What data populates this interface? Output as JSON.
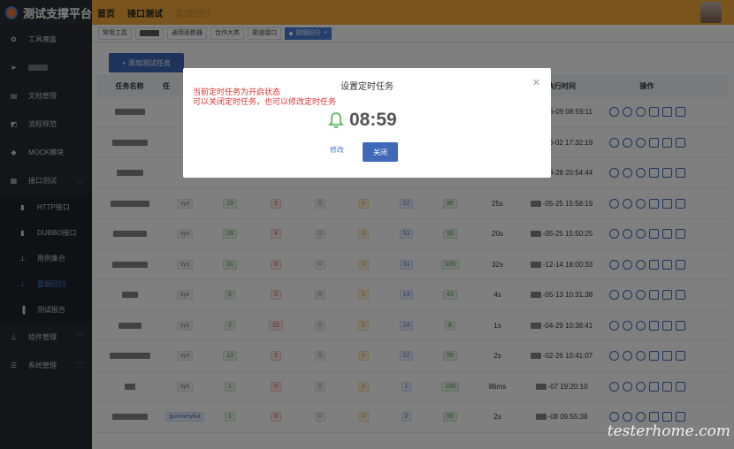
{
  "app": {
    "title": "测试支撑平台",
    "nav": [
      "首页",
      "接口测试",
      "冒烟回归"
    ]
  },
  "sidebar": {
    "items": [
      {
        "label": "工具魔盒",
        "icon": "gear-icon"
      },
      {
        "label": "■■■",
        "icon": "send-icon",
        "blurred": true
      },
      {
        "label": "文档管理",
        "icon": "doc-icon"
      },
      {
        "label": "流程规范",
        "icon": "flow-icon"
      },
      {
        "label": "MOCK模块",
        "icon": "box-icon"
      },
      {
        "label": "接口测试",
        "icon": "grid-icon",
        "expanded": true
      }
    ],
    "subitems": [
      {
        "label": "HTTP接口",
        "icon": "doc-icon"
      },
      {
        "label": "DUBBO接口",
        "icon": "doc-icon"
      },
      {
        "label": "用例集合",
        "icon": "tree-icon"
      },
      {
        "label": "冒烟回归",
        "icon": "tree-icon",
        "active": true
      },
      {
        "label": "测试报告",
        "icon": "bar-icon"
      }
    ],
    "bottom": [
      {
        "label": "组件管理",
        "icon": "tree-icon"
      },
      {
        "label": "系统管理",
        "icon": "list-icon"
      }
    ]
  },
  "tabs": [
    {
      "label": "常用工具"
    },
    {
      "label": "■■■",
      "blurred": true
    },
    {
      "label": "通用适数器"
    },
    {
      "label": "合作大类"
    },
    {
      "label": "渠道接口"
    },
    {
      "label": "冒烟回归",
      "active": true
    }
  ],
  "add_button": "+ 添加测试任务",
  "table": {
    "headers": [
      "任务名称",
      "任",
      "",
      "",
      "",
      "",
      "",
      "",
      "",
      "执行时间",
      "操作"
    ],
    "rows": [
      {
        "creator": "",
        "total": "",
        "fail": "",
        "skip": "",
        "warn": "",
        "pass": "",
        "pct": "",
        "dur": "",
        "time": "-06-09 08:59:11"
      },
      {
        "creator": "",
        "total": "",
        "fail": "",
        "skip": "",
        "warn": "",
        "pass": "",
        "pct": "",
        "dur": "",
        "time": "-06-02 17:32:19"
      },
      {
        "creator": "",
        "total": "",
        "fail": "",
        "skip": "",
        "warn": "",
        "pass": "",
        "pct": "",
        "dur": "",
        "time": "-08-28 20:54:44"
      },
      {
        "creator": "sys",
        "total": "19",
        "fail": "3",
        "skip": "0",
        "warn": "0",
        "pass": "22",
        "pct": "86",
        "dur": "25s",
        "time": "-05-25 15:58:19"
      },
      {
        "creator": "sys",
        "total": "28",
        "fail": "4",
        "skip": "0",
        "warn": "0",
        "pass": "51",
        "pct": "55",
        "dur": "20s",
        "time": "-05-25 15:50:25"
      },
      {
        "creator": "sys",
        "total": "31",
        "fail": "0",
        "skip": "0",
        "warn": "0",
        "pass": "31",
        "pct": "100",
        "dur": "32s",
        "time": "-12-14 18:00:33"
      },
      {
        "creator": "sys",
        "total": "6",
        "fail": "0",
        "skip": "0",
        "warn": "0",
        "pass": "14",
        "pct": "43",
        "dur": "4s",
        "time": "-05-13 10:31:38"
      },
      {
        "creator": "sys",
        "total": "2",
        "fail": "22",
        "skip": "0",
        "warn": "0",
        "pass": "24",
        "pct": "8",
        "dur": "1s",
        "time": "-04-29 10:38:41"
      },
      {
        "creator": "sys",
        "total": "13",
        "fail": "3",
        "skip": "0",
        "warn": "0",
        "pass": "22",
        "pct": "59",
        "dur": "2s",
        "time": "-02-26 10:41:07"
      },
      {
        "creator": "sys",
        "total": "1",
        "fail": "0",
        "skip": "0",
        "warn": "0",
        "pass": "1",
        "pct": "100",
        "dur": "86ms",
        "time": "-07 19:20:10"
      },
      {
        "creator": "guomeiyika",
        "total": "1",
        "fail": "0",
        "skip": "0",
        "warn": "0",
        "pass": "2",
        "pct": "50",
        "dur": "2s",
        "time": "-08 09:55:38"
      }
    ]
  },
  "dialog": {
    "title": "设置定时任务",
    "line1": "当前定时任务为开启状态",
    "line2": "可以关闭定时任务，也可以修改定时任务",
    "time": "08:59",
    "edit_label": "修改",
    "close_label": "关闭"
  },
  "watermark": "testerhome.com",
  "colors": {
    "topbar": "#f2a83a",
    "sidebar": "#262b31",
    "primary": "#3f68b8",
    "alert": "#e0322f"
  }
}
